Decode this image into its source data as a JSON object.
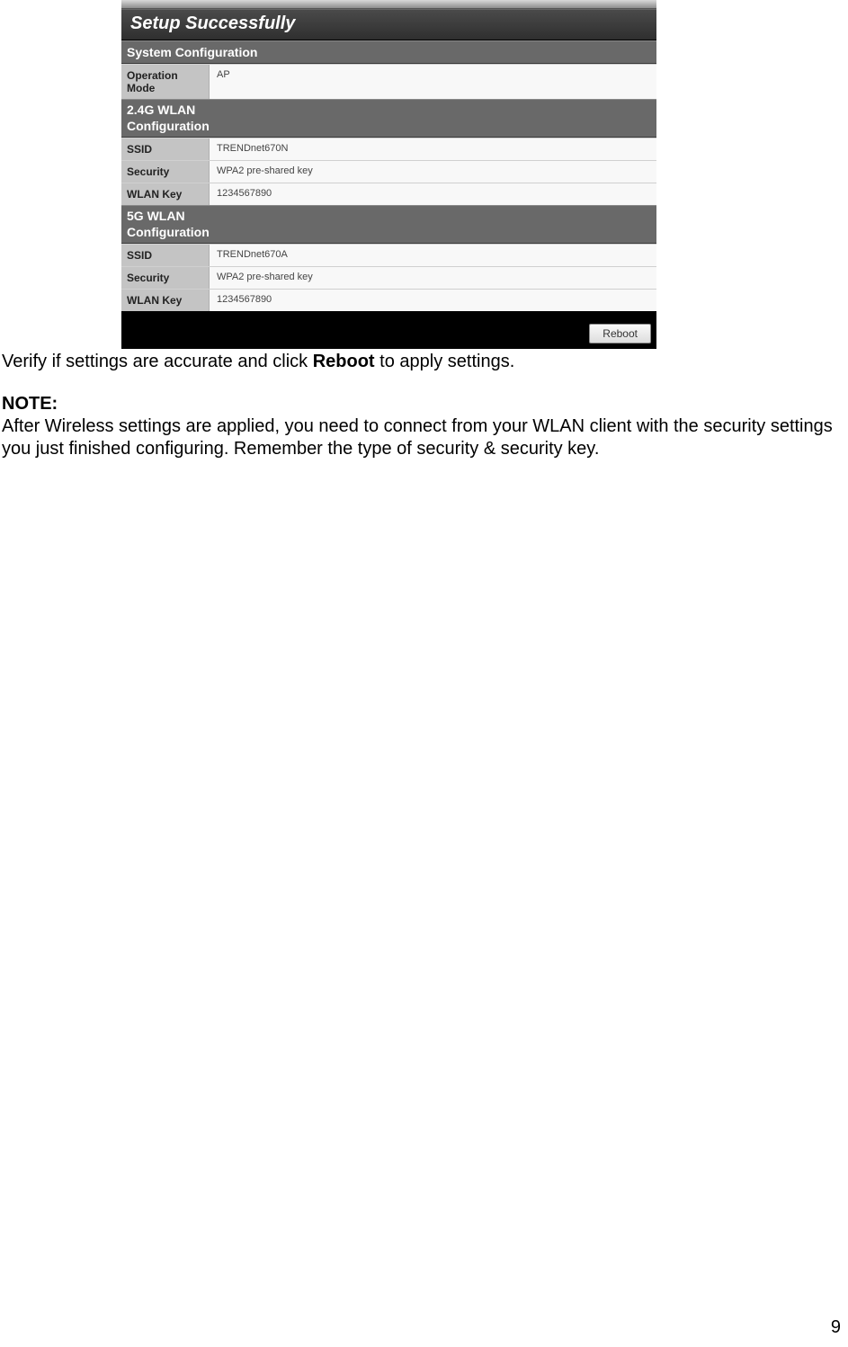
{
  "panel": {
    "title": "Setup Successfully",
    "sections": [
      {
        "heading": "System Configuration",
        "rows": [
          {
            "label": "Operation Mode",
            "value": "AP"
          }
        ]
      },
      {
        "heading": "2.4G WLAN Configuration",
        "multiline": true,
        "rows": [
          {
            "label": "SSID",
            "value": "TRENDnet670N"
          },
          {
            "label": "Security",
            "value": "WPA2 pre-shared key"
          },
          {
            "label": "WLAN Key",
            "value": "1234567890"
          }
        ]
      },
      {
        "heading": "5G WLAN Configuration",
        "multiline": true,
        "rows": [
          {
            "label": "SSID",
            "value": "TRENDnet670A"
          },
          {
            "label": "Security",
            "value": "WPA2 pre-shared key"
          },
          {
            "label": "WLAN Key",
            "value": "1234567890"
          }
        ]
      }
    ],
    "reboot_label": "Reboot"
  },
  "doc": {
    "verify_prefix": "Verify if settings are accurate and click ",
    "verify_bold": "Reboot",
    "verify_suffix": " to apply settings.",
    "note_label": "NOTE:",
    "note_body": "After Wireless settings are applied, you need to connect from your WLAN client with the security settings you just finished configuring. Remember the type of security & security key."
  },
  "page_number": "9"
}
